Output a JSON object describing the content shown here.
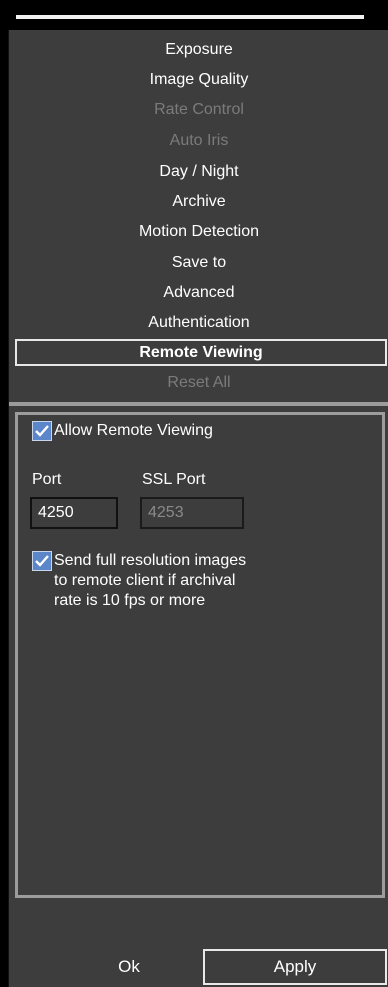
{
  "menu": {
    "items": [
      {
        "label": "Exposure"
      },
      {
        "label": "Image Quality"
      },
      {
        "label": "Rate Control"
      },
      {
        "label": "Auto Iris"
      },
      {
        "label": "Day / Night"
      },
      {
        "label": "Archive"
      },
      {
        "label": "Motion Detection"
      },
      {
        "label": "Save to"
      },
      {
        "label": "Advanced"
      },
      {
        "label": "Authentication"
      },
      {
        "label": "Remote Viewing"
      },
      {
        "label": "Reset All"
      }
    ]
  },
  "remote_viewing": {
    "allow_label": "Allow Remote Viewing",
    "allow_checked": true,
    "port_label": "Port",
    "port_value": "4250",
    "ssl_port_label": "SSL Port",
    "ssl_port_value": "4253",
    "full_res_label_line1": "Send full resolution images",
    "full_res_label_line2": "to remote client if archival",
    "full_res_label_line3": "rate is 10 fps or more",
    "full_res_checked": true
  },
  "footer": {
    "ok_label": "Ok",
    "apply_label": "Apply"
  },
  "colors": {
    "panel_bg": "#3d3d3d",
    "disabled_text": "#7b7b7b",
    "checkbox_blue": "#5b86c9"
  }
}
